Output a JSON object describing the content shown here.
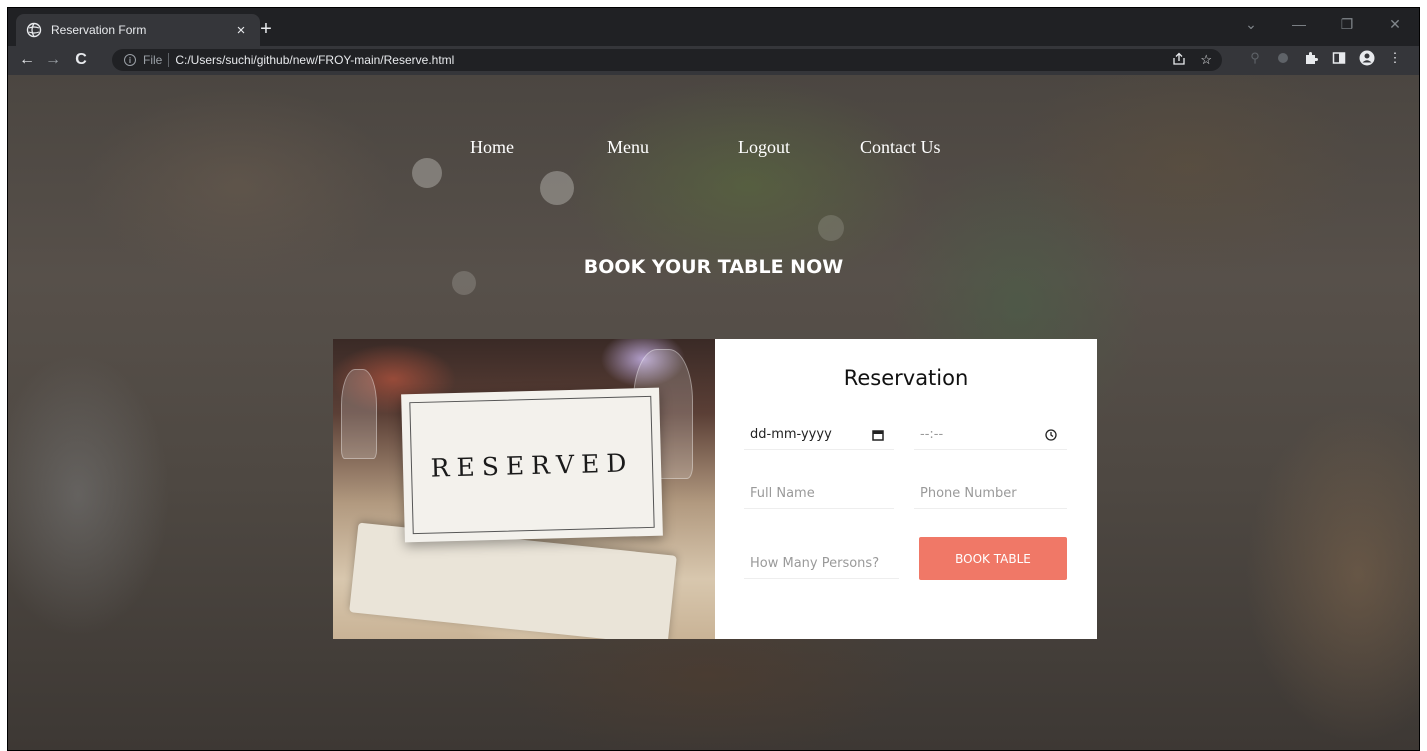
{
  "browser": {
    "tab_title": "Reservation Form",
    "tab_close": "×",
    "new_tab": "+",
    "back": "←",
    "forward": "→",
    "reload": "C",
    "file_label": "File",
    "url": "C:/Users/suchi/github/new/FROY-main/Reserve.html",
    "minimize": "—",
    "restore": "❐",
    "close": "✕",
    "tab_search": "⌄"
  },
  "nav": {
    "items": [
      "Home",
      "Menu",
      "Logout",
      "Contact Us"
    ]
  },
  "page": {
    "headline": "BOOK YOUR TABLE NOW"
  },
  "photo": {
    "sign_text": "RESERVED"
  },
  "form": {
    "title": "Reservation",
    "date_value": "dd-mm-yyyy",
    "time_value": "--:--",
    "full_name_placeholder": "Full Name",
    "phone_placeholder": "Phone Number",
    "persons_placeholder": "How Many Persons?",
    "submit_label": "BOOK TABLE"
  },
  "colors": {
    "accent": "#f07867",
    "browser_bg": "#202124",
    "toolbar_bg": "#35363a"
  }
}
